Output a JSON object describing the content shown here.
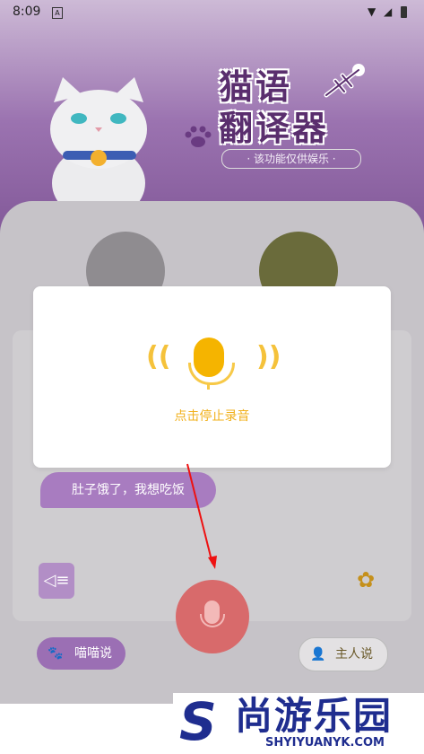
{
  "status_bar": {
    "time": "8:09",
    "sim_label": "A"
  },
  "header": {
    "title_line1": "猫语",
    "title_line2": "翻译器",
    "subtitle": "· 该功能仅供娱乐 ·"
  },
  "dialog": {
    "stop_text": "点击停止录音"
  },
  "chat": {
    "bubble_text": "肚子饿了，我想吃饭"
  },
  "buttons": {
    "meow_label": "喵喵说",
    "owner_label": "主人说"
  },
  "watermark": {
    "brand_cn": "尚游乐园",
    "brand_url": "SHYIYUANYK.COM"
  },
  "colors": {
    "accent_purple": "#9b6fb4",
    "mic_yellow": "#f5b400",
    "record_red": "#d86a6b",
    "watermark_blue": "#1f2d8f"
  }
}
